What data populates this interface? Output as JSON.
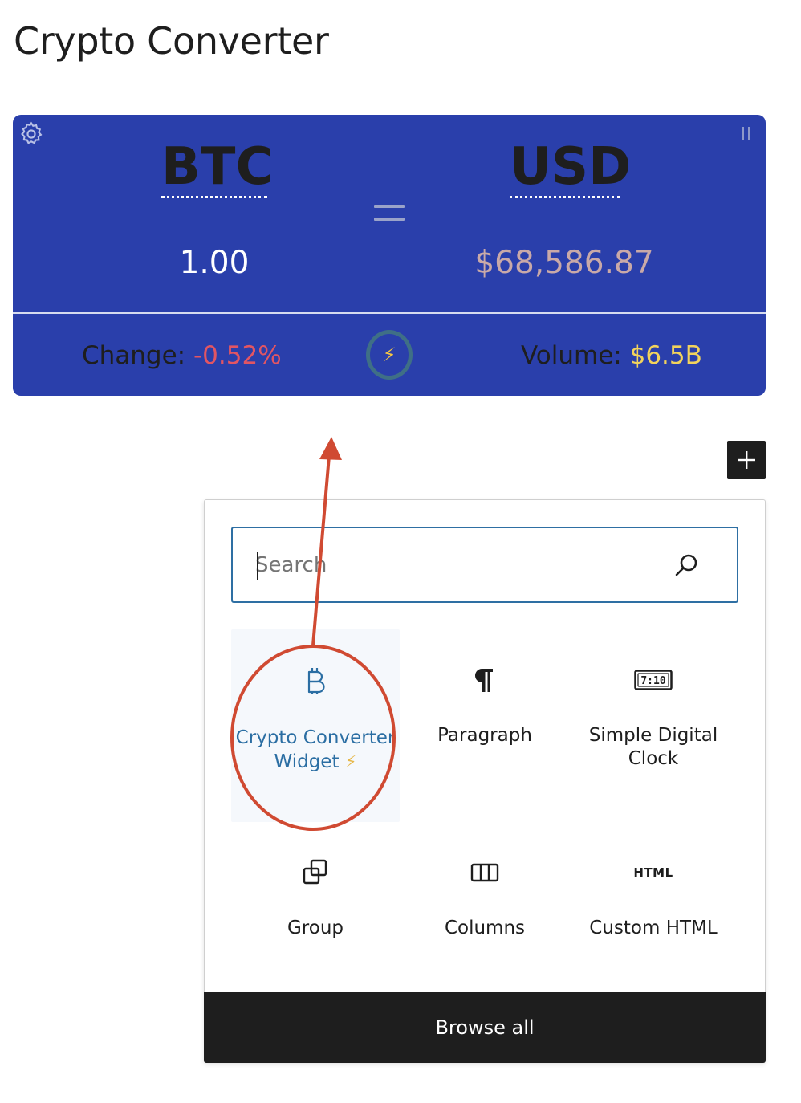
{
  "page": {
    "title": "Crypto Converter"
  },
  "widget": {
    "from_code": "BTC",
    "to_code": "USD",
    "from_amount": "1.00",
    "to_amount": "$68,586.87",
    "change_label": "Change: ",
    "change_value": "-0.52%",
    "volume_label": "Volume: ",
    "volume_value": "$6.5B",
    "colors": {
      "background": "#2a3fab",
      "negative": "#e25563",
      "volume": "#f2d35c",
      "converted": "#c9a9a8"
    }
  },
  "inserter": {
    "search_placeholder": "Search",
    "blocks": [
      {
        "label": "Crypto Converter Widget",
        "icon": "bitcoin-icon",
        "highlighted": true
      },
      {
        "label": "Paragraph",
        "icon": "paragraph-icon"
      },
      {
        "label": "Simple Digital Clock",
        "icon": "digital-clock-icon",
        "icon_text": "7:10"
      },
      {
        "label": "Group",
        "icon": "group-icon"
      },
      {
        "label": "Columns",
        "icon": "columns-icon"
      },
      {
        "label": "Custom HTML",
        "icon": "html-icon",
        "icon_text": "HTML"
      }
    ],
    "browse_all_label": "Browse all"
  },
  "annotation": {
    "color": "#d04a32",
    "shapes": [
      "ellipse-around-crypto-converter-widget",
      "arrow-to-converter"
    ]
  }
}
